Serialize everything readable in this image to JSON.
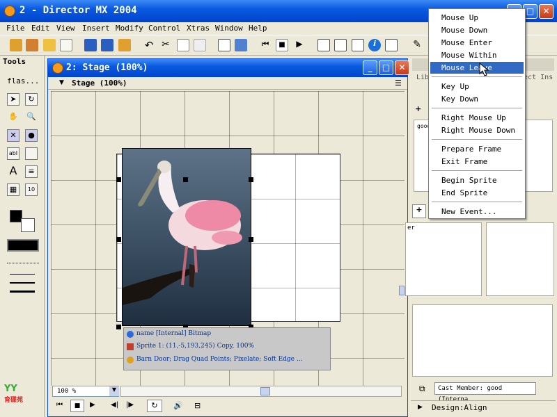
{
  "app": {
    "title": "2 - Director MX 2004"
  },
  "menubar": [
    "File",
    "Edit",
    "View",
    "Insert",
    "Modify",
    "Control",
    "Xtras",
    "Window",
    "Help"
  ],
  "tools": {
    "header": "Tools",
    "dropdown": "flas..."
  },
  "stage_window": {
    "title": "2: Stage (100%)",
    "subheader": "Stage (100%)",
    "zoom_value": "100 %"
  },
  "sprite_overlay": {
    "line1": "name [Internal] Bitmap",
    "line2": "Sprite 1: (11,-5,193,245) Copy, 100%",
    "line3": "Barn Door; Drag Quad Points; Pixelate; Soft Edge ..."
  },
  "right_panel": {
    "library_tab": "Libr",
    "object_tab": "oject Ins",
    "library_item": "good",
    "behavior_item": "er",
    "cast_member_label": "Cast Member:",
    "cast_member_value": "good (Interna",
    "design_panel": "Design:Align"
  },
  "context_menu": {
    "items_group1": [
      "Mouse Up",
      "Mouse Down",
      "Mouse Enter",
      "Mouse Within",
      "Mouse Leave"
    ],
    "items_group2": [
      "Key Up",
      "Key Down"
    ],
    "items_group3": [
      "Right Mouse Up",
      "Right Mouse Down"
    ],
    "items_group4": [
      "Prepare Frame",
      "Exit Frame"
    ],
    "items_group5": [
      "Begin Sprite",
      "End Sprite"
    ],
    "items_group6": [
      "New Event..."
    ],
    "highlighted": "Mouse Leave"
  },
  "colors": {
    "titlebar": "#0a5ae0",
    "highlight": "#316ac5",
    "chrome": "#ece9d8"
  },
  "logo_text": "育碟苑"
}
